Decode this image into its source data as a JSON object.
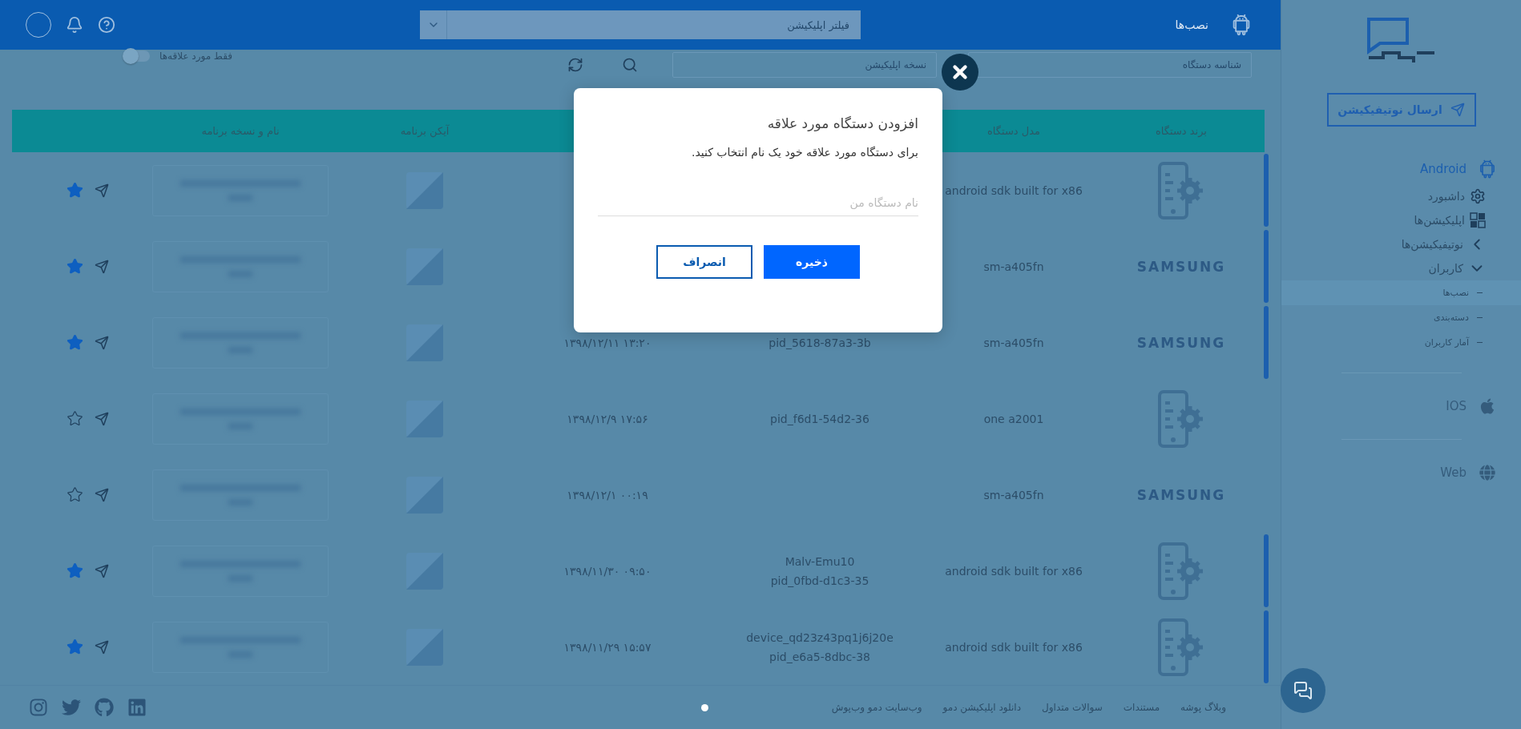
{
  "top_bar": {
    "section_label": "نصب‌ها",
    "filter_placeholder": "فیلتر اپلیکیشن"
  },
  "filters": {
    "device_id_placeholder": "شناسه دستگاه",
    "app_version_placeholder": "نسخه اپلیکیشن",
    "favorites_only": {
      "label": "فقط مورد علاقه‌ها",
      "on": false
    }
  },
  "table": {
    "header": {
      "brand": "برند دستگاه",
      "model": "مدل دستگاه",
      "app_icon": "آیکن برنامه",
      "app_name": "نام و نسخه برنامه"
    },
    "rows": [
      {
        "brand": {
          "kind": "generic"
        },
        "model": "android sdk built for x86",
        "favorite": true
      },
      {
        "brand": {
          "kind": "logo",
          "text": "SAMSUNG"
        },
        "model": "sm-a405fn",
        "favorite": true
      },
      {
        "brand": {
          "kind": "logo",
          "text": "SAMSUNG"
        },
        "model": "sm-a405fn",
        "device_lines": [
          "pid_5618-87a3-3b"
        ],
        "date": "۱۳۹۸/۱۲/۱۱ ۱۳:۲۰",
        "favorite": true
      },
      {
        "brand": {
          "kind": "generic"
        },
        "model": "one a2001",
        "device_lines": [
          "pid_f6d1-54d2-36"
        ],
        "date": "۱۳۹۸/۱۲/۹ ۱۷:۵۶",
        "favorite": false
      },
      {
        "brand": {
          "kind": "logo",
          "text": "SAMSUNG"
        },
        "model": "sm-a405fn",
        "date": "۱۳۹۸/۱۲/۱ ۰۰:۱۹",
        "favorite": false
      },
      {
        "brand": {
          "kind": "generic"
        },
        "model": "android sdk built for x86",
        "device_lines": [
          "Malv-Emu10",
          "pid_0fbd-d1c3-35"
        ],
        "date": "۱۳۹۸/۱۱/۳۰ ۰۹:۵۰",
        "favorite": true
      },
      {
        "brand": {
          "kind": "generic"
        },
        "model": "android sdk built for x86",
        "device_lines": [
          "device_qd23z43pq1j6j20e",
          "pid_e6a5-8dbc-38"
        ],
        "date": "۱۳۹۸/۱۱/۲۹ ۱۵:۵۷",
        "favorite": true
      }
    ]
  },
  "modal": {
    "title": "افزودن دستگاه مورد علاقه",
    "message": "برای دستگاه مورد علاقه خود یک نام انتخاب کنید.",
    "name_placeholder": "نام دستگاه من",
    "buttons": [
      {
        "label": "ذخیره",
        "kind": "primary"
      },
      {
        "label": "انصراف",
        "kind": "secondary"
      }
    ]
  },
  "sidebar": {
    "send_button": "ارسال نوتیفیکیشن",
    "platforms": [
      {
        "label": "Android",
        "kind": "android",
        "selected": true,
        "disabled": false,
        "items": [
          {
            "label": "داشبورد",
            "kind": "dashboard"
          },
          {
            "label": "اپلیکیشن‌ها",
            "kind": "apps"
          },
          {
            "label": "نوتیفیکیشن‌ها",
            "kind": "group",
            "expanded": false
          },
          {
            "label": "کاربران",
            "kind": "group",
            "expanded": true,
            "children": [
              {
                "label": "نصب‌ها",
                "selected": true
              },
              {
                "label": "دسته‌بندی",
                "selected": false
              },
              {
                "label": "آمار کاربران",
                "selected": false
              }
            ]
          }
        ]
      },
      {
        "label": "IOS",
        "kind": "apple",
        "selected": false,
        "disabled": true
      },
      {
        "label": "Web",
        "kind": "web",
        "selected": false,
        "disabled": true
      }
    ]
  },
  "footer": {
    "links": [
      "وبلاگ پوشه",
      "مستندات",
      "سوالات متداول",
      "دانلود اپلیکیشن دمو",
      "وب‌سایت دمو وب‌پوش"
    ],
    "social": [
      {
        "kind": "linkedin"
      },
      {
        "kind": "github"
      },
      {
        "kind": "twitter"
      },
      {
        "kind": "instagram"
      }
    ]
  }
}
